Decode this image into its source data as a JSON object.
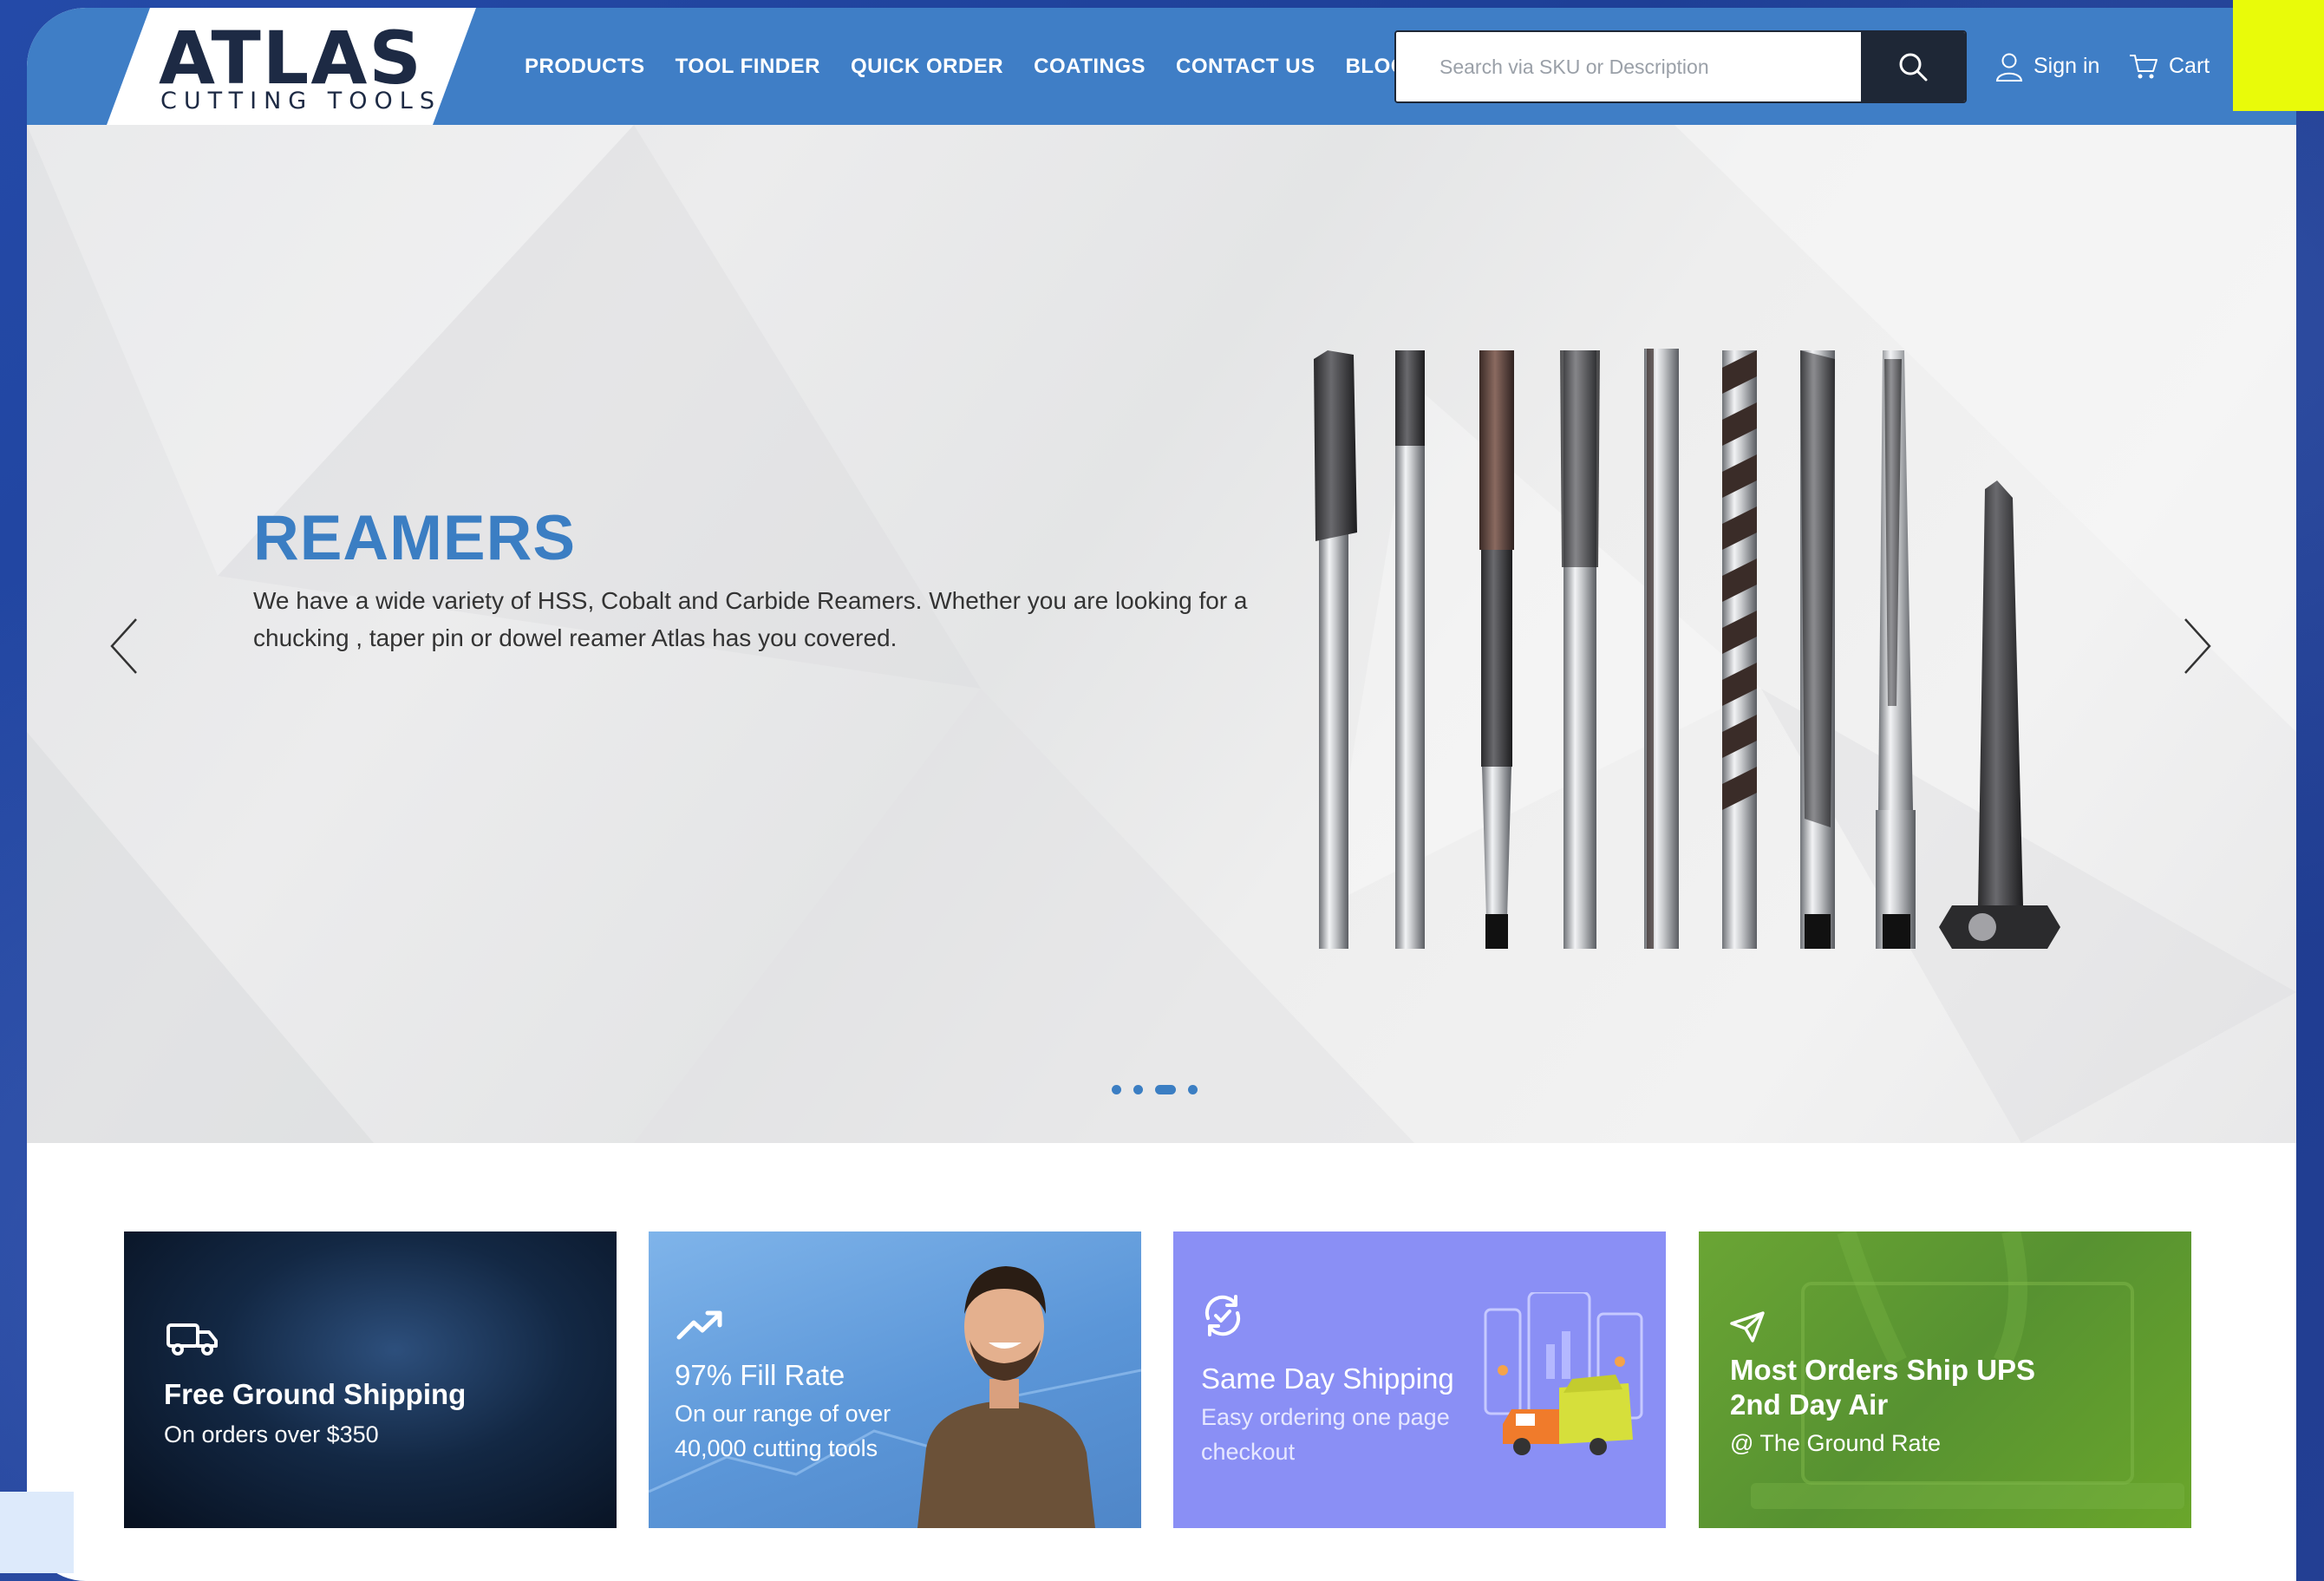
{
  "brand": {
    "name": "ATLAS",
    "tagline": "CUTTING TOOLS"
  },
  "nav": [
    {
      "label": "PRODUCTS"
    },
    {
      "label": "TOOL FINDER"
    },
    {
      "label": "QUICK ORDER"
    },
    {
      "label": "COATINGS"
    },
    {
      "label": "CONTACT US"
    },
    {
      "label": "BLOG"
    }
  ],
  "search": {
    "placeholder": "Search via SKU or Description",
    "icon": "search-icon"
  },
  "account": {
    "signin": "Sign in",
    "cart": "Cart"
  },
  "hero": {
    "title": "REAMERS",
    "text": "We have a wide variety of HSS, Cobalt and Carbide Reamers. Whether you are looking for a chucking , taper pin or dowel reamer Atlas has you covered.",
    "slides": 4,
    "active_slide": 3
  },
  "features": [
    {
      "title": "Free Ground Shipping",
      "subtitle": "On orders over $350",
      "icon": "truck-icon",
      "color": "#0c1c33"
    },
    {
      "title": "97% Fill Rate",
      "subtitle": "On our range of over 40,000 cutting tools",
      "icon": "trend-up-icon",
      "color": "#5b96d8"
    },
    {
      "title": "Same Day Shipping",
      "subtitle": "Easy ordering one page checkout",
      "icon": "refresh-check-icon",
      "color": "#8a8ff5"
    },
    {
      "title": "Most Orders Ship UPS 2nd Day Air",
      "subtitle": "@ The Ground Rate",
      "icon": "paper-plane-icon",
      "color": "#5f9a2c"
    }
  ],
  "colors": {
    "header": "#3f7ec6",
    "accent": "#3b7ec3",
    "dark": "#1e2736",
    "highlight": "#e9fb09"
  }
}
